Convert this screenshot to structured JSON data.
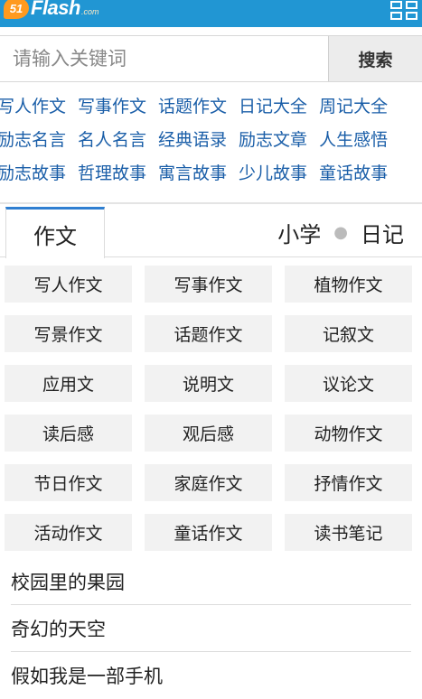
{
  "header": {
    "logo_number": "51",
    "logo_text": "Flash",
    "logo_suffix": ".com",
    "menu_icon": "grid-menu-icon",
    "background_color": "#2196d3"
  },
  "search": {
    "placeholder": "请输入关键词",
    "button_label": "搜索"
  },
  "quick_links": [
    [
      "写人作文",
      "写事作文",
      "话题作文",
      "日记大全",
      "周记大全"
    ],
    [
      "励志名言",
      "名人名言",
      "经典语录",
      "励志文章",
      "人生感悟"
    ],
    [
      "励志故事",
      "哲理故事",
      "寓言故事",
      "少儿故事",
      "童话故事"
    ]
  ],
  "tabs": {
    "active": "作文",
    "others": [
      "小学",
      "日记"
    ],
    "active_color": "#2f7fd1"
  },
  "categories": [
    "写人作文",
    "写事作文",
    "植物作文",
    "写景作文",
    "话题作文",
    "记叙文",
    "应用文",
    "说明文",
    "议论文",
    "读后感",
    "观后感",
    "动物作文",
    "节日作文",
    "家庭作文",
    "抒情作文",
    "活动作文",
    "童话作文",
    "读书笔记"
  ],
  "articles": [
    "校园里的果园",
    "奇幻的天空",
    "假如我是一部手机"
  ],
  "colors": {
    "link": "#1a5ea8",
    "category_bg": "#f2f2f2"
  }
}
